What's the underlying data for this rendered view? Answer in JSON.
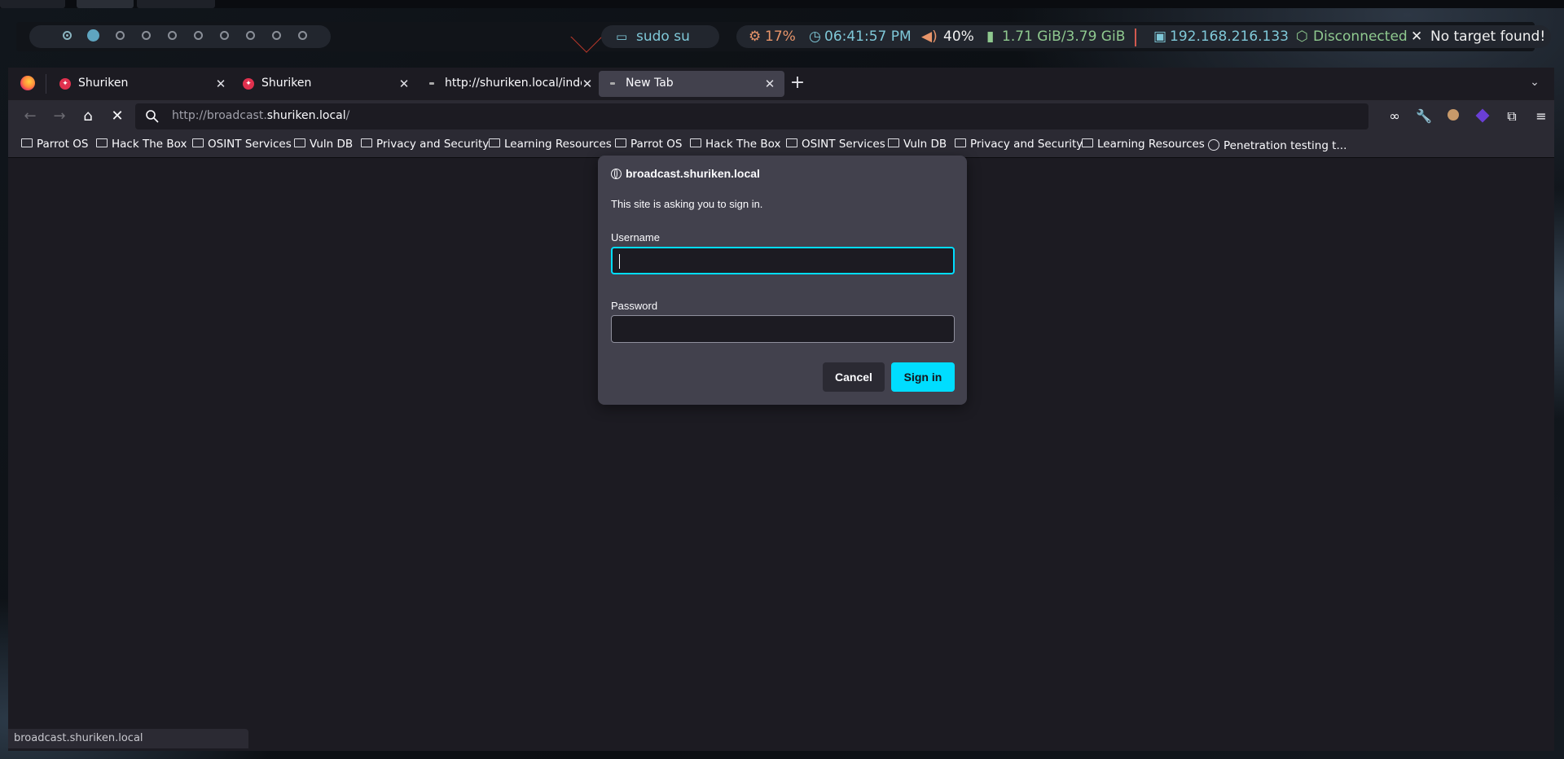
{
  "polybar": {
    "workspaces": [
      {
        "state": "active"
      },
      {
        "state": "current"
      },
      {
        "state": "empty"
      },
      {
        "state": "empty"
      },
      {
        "state": "empty"
      },
      {
        "state": "empty"
      },
      {
        "state": "empty"
      },
      {
        "state": "empty"
      },
      {
        "state": "empty"
      },
      {
        "state": "empty"
      }
    ],
    "command": "sudo su",
    "cpu": "17%",
    "time": "06:41:57 PM",
    "volume": "40%",
    "memory": "1.71 GiB/3.79 GiB",
    "ip": "192.168.216.133",
    "vpn_status": "Disconnected",
    "target": "No target found!",
    "colors": {
      "cyan": "#7fc8d8",
      "orange": "#e8956a",
      "green": "#8fc98f",
      "red": "#d2594f"
    }
  },
  "browser": {
    "tabs": [
      {
        "label": "Shuriken",
        "favicon": "shuriken-icon",
        "selected": false
      },
      {
        "label": "Shuriken",
        "favicon": "shuriken-icon",
        "selected": false
      },
      {
        "label": "http://shuriken.local/index",
        "favicon": "loading-icon",
        "selected": false
      },
      {
        "label": "New Tab",
        "favicon": "loading-icon",
        "selected": true
      }
    ],
    "url_prefix": "http://broadcast.",
    "url_host": "shuriken.local",
    "url_suffix": "/",
    "bookmarks": [
      "Parrot OS",
      "Hack The Box",
      "OSINT Services",
      "Vuln DB",
      "Privacy and Security",
      "Learning Resources",
      "Parrot OS",
      "Hack The Box",
      "OSINT Services",
      "Vuln DB",
      "Privacy and Security",
      "Learning Resources",
      "Penetration testing t..."
    ],
    "status_url": "broadcast.shuriken.local"
  },
  "dialog": {
    "host": "broadcast.shuriken.local",
    "message": "This site is asking you to sign in.",
    "username_label": "Username",
    "username_value": "",
    "password_label": "Password",
    "password_value": "",
    "cancel_label": "Cancel",
    "signin_label": "Sign in",
    "accent": "#00ddff"
  }
}
